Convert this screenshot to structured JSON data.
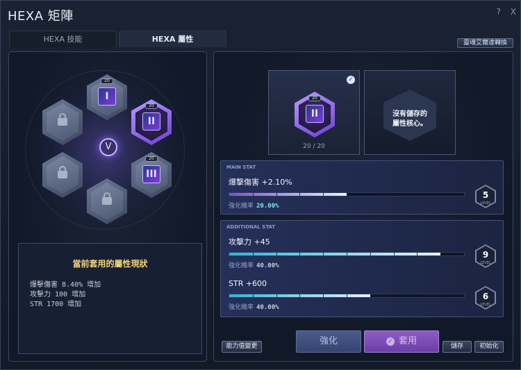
{
  "window": {
    "title": "HEXA 矩陣",
    "help_glyph": "?",
    "close_glyph": "X"
  },
  "tabs": [
    {
      "label": "HEXA 技能",
      "active": false
    },
    {
      "label": "HEXA 屬性",
      "active": true
    }
  ],
  "convert_button": "靈魂艾爾達轉換",
  "matrix": {
    "center_symbol": "V",
    "slots": [
      {
        "state": "locked",
        "icon": "lock-icon"
      },
      {
        "state": "unlocked",
        "level_chip": "20",
        "roman": "I",
        "icon": "attribute-core-1-icon"
      },
      {
        "state": "active",
        "level_chip": "20",
        "roman": "II",
        "icon": "attribute-core-2-icon"
      },
      {
        "state": "locked",
        "icon": "lock-icon"
      },
      {
        "state": "unlocked",
        "level_chip": "20",
        "roman": "III",
        "icon": "attribute-core-3-icon"
      },
      {
        "state": "locked",
        "icon": "lock-icon"
      }
    ]
  },
  "status": {
    "title": "當前套用的屬性現狀",
    "lines": [
      "爆擊傷害 8.40% 增加",
      "攻擊力 100 增加",
      "STR 1700 增加"
    ]
  },
  "core_slots": {
    "current": {
      "level_chip": "20",
      "roman": "II",
      "count": "20 / 20",
      "selected": true
    },
    "saved_empty_text": "沒有儲存的\n屬性核心。"
  },
  "main_stat": {
    "tag": "MAIN STAT",
    "name": "爆擊傷害 +2.10%",
    "rate_label": "強化機率",
    "rate_value": "20.00%",
    "level": "5",
    "level_word": "LEVEL",
    "progress": 0.5,
    "bar_color": "#7b4fd6"
  },
  "additional_stats": {
    "tag": "ADDITIONAL STAT",
    "items": [
      {
        "name": "攻擊力 +45",
        "rate_label": "強化機率",
        "rate_value": "40.00%",
        "level": "9",
        "level_word": "LEVEL",
        "progress": 0.9,
        "bar_color": "#2fb4d6"
      },
      {
        "name": "STR +600",
        "rate_label": "強化機率",
        "rate_value": "40.00%",
        "level": "6",
        "level_word": "LEVEL",
        "progress": 0.6,
        "bar_color": "#2fb4d6"
      }
    ]
  },
  "buttons": {
    "reset_stats": "能力值變更",
    "enhance": "強化",
    "apply": "套用",
    "apply_icon": "check-icon",
    "save": "儲存",
    "initialize": "初始化"
  }
}
